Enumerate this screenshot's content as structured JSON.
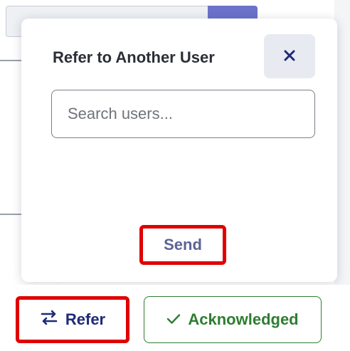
{
  "popover": {
    "title": "Refer to Another User",
    "close_icon": "close-icon",
    "search": {
      "placeholder": "Search users...",
      "value": ""
    },
    "send_label": "Send"
  },
  "actions": {
    "refer_label": "Refer",
    "refer_icon": "transfer-arrows-icon",
    "acknowledged_label": "Acknowledged",
    "acknowledged_icon": "checkmark-icon"
  },
  "colors": {
    "highlight": "#e00000",
    "refer_text": "#1e2a78",
    "send_text": "#5c6396",
    "acknowledged": "#2e7d32",
    "close_bg": "#e8eaf1"
  }
}
